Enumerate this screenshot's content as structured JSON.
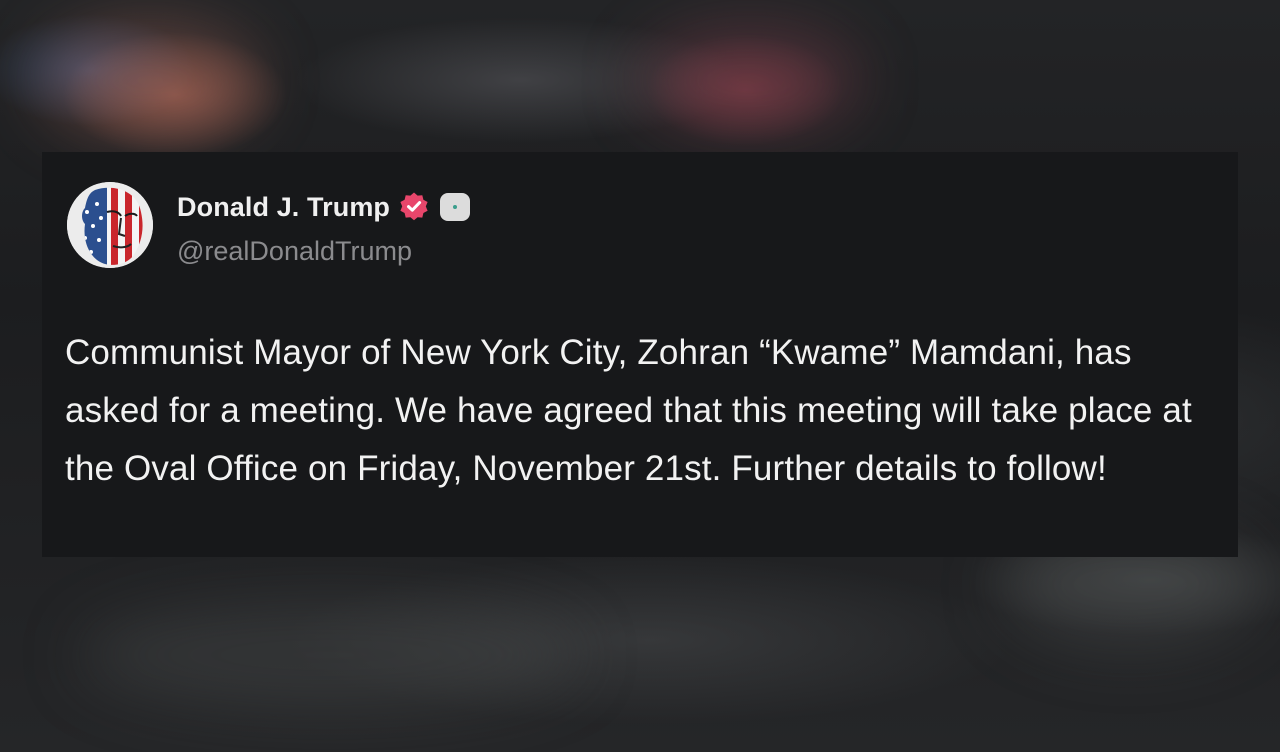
{
  "post": {
    "author": {
      "display_name": "Donald J. Trump",
      "handle": "@realDonaldTrump",
      "avatar_icon": "american-flag-face-avatar",
      "verified_icon": "verified-badge-icon",
      "verified_color": "#e8466b",
      "app_icon": "app-badge-icon"
    },
    "text": "Communist Mayor of New York City, Zohran “Kwame” Mamdani, has asked for a meeting. We have agreed that this meeting will take place at the Oval Office on Friday, November 21st. Further details to follow!"
  },
  "colors": {
    "card_background": "#17181a",
    "page_background": "#1f2022",
    "primary_text": "#f2f2f2",
    "secondary_text": "#8b8b8e"
  }
}
